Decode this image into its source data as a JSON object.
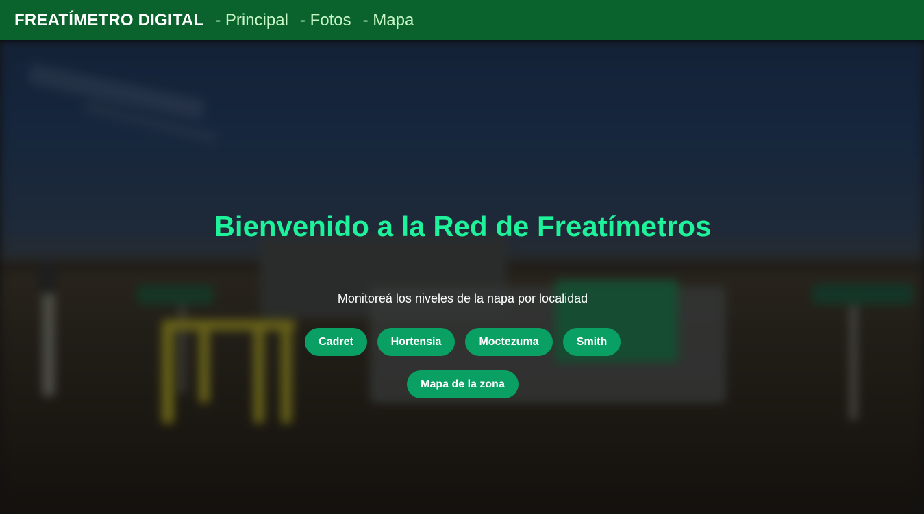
{
  "header": {
    "brand": "FREATÍMETRO DIGITAL",
    "nav": [
      {
        "label": "- Principal"
      },
      {
        "label": "- Fotos"
      },
      {
        "label": "- Mapa"
      }
    ]
  },
  "hero": {
    "title": "Bienvenido a la Red de Freatímetros",
    "subtitle": "Monitoreá los niveles de la napa por localidad",
    "localities": [
      {
        "label": "Cadret"
      },
      {
        "label": "Hortensia"
      },
      {
        "label": "Moctezuma"
      },
      {
        "label": "Smith"
      }
    ],
    "map_button": "Mapa de la zona"
  },
  "colors": {
    "header_bg": "#0a622d",
    "title": "#1ef29a",
    "button_bg": "#0aa063"
  }
}
